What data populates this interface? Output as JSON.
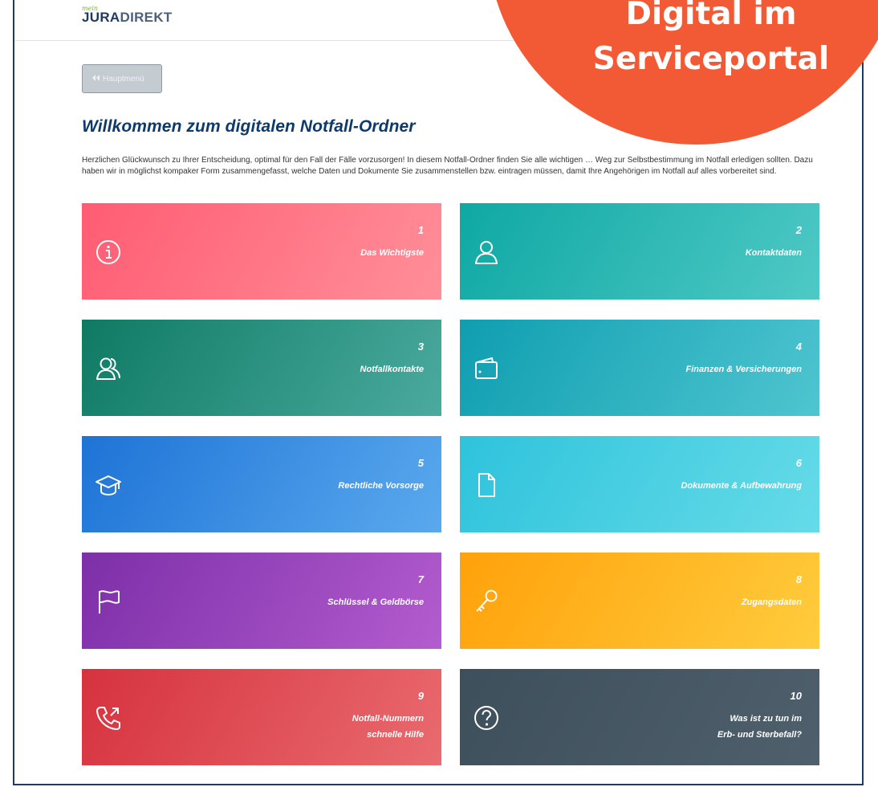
{
  "header": {
    "logo_small": "mein",
    "logo_primary": "JURA",
    "logo_secondary": "DIREKT"
  },
  "menu_button": {
    "icon": "double-chevron-left-icon",
    "label": "Hauptmenü"
  },
  "page": {
    "title": "Willkommen zum digitalen Notfall-Ordner",
    "intro": "Herzlichen Glückwunsch zu Ihrer Entscheidung, optimal für den Fall der Fälle vorzusorgen! In diesem Notfall-Ordner finden Sie alle wichtigen … Weg zur Selbstbestimmung im Notfall erledigen sollten. Dazu haben wir in möglichst kompaker Form zusammengefasst, welche Daten und Dokumente Sie zusammenstellen bzw. eintragen müssen, damit Ihre Angehörigen im Notfall auf alles vorbereitet sind."
  },
  "tiles": [
    {
      "number": "1",
      "label": "Das Wichtigste",
      "icon": "info-icon",
      "color_from": "#ff5c73",
      "color_to": "#ff8f99"
    },
    {
      "number": "2",
      "label": "Kontaktdaten",
      "icon": "person-icon",
      "color_from": "#0fa8a3",
      "color_to": "#4fc9c6"
    },
    {
      "number": "3",
      "label": "Notfallkontakte",
      "icon": "people-icon",
      "color_from": "#0f7a64",
      "color_to": "#4aaa9e"
    },
    {
      "number": "4",
      "label": "Finanzen & Versicherungen",
      "icon": "wallet-icon",
      "color_from": "#0f9eb0",
      "color_to": "#4fc5d0"
    },
    {
      "number": "5",
      "label": "Rechtliche Vorsorge",
      "icon": "graduation-cap-icon",
      "color_from": "#1e73d6",
      "color_to": "#5aa9ee"
    },
    {
      "number": "6",
      "label": "Dokumente & Aufbewahrung",
      "icon": "document-icon",
      "color_from": "#2ec3dc",
      "color_to": "#66dbe8"
    },
    {
      "number": "7",
      "label": "Schlüssel & Geldbörse",
      "icon": "flag-icon",
      "color_from": "#7d2fa8",
      "color_to": "#b35ccf"
    },
    {
      "number": "8",
      "label": "Zugangsdaten",
      "icon": "key-icon",
      "color_from": "#ffa10a",
      "color_to": "#ffcc3d"
    },
    {
      "number": "9",
      "label_lines": [
        "Notfall-Nummern",
        "schnelle Hilfe"
      ],
      "icon": "phone-call-icon",
      "color_from": "#d6323e",
      "color_to": "#e96b6f"
    },
    {
      "number": "10",
      "label_lines": [
        "Was ist zu tun im",
        "Erb- und Sterbefall?"
      ],
      "icon": "question-icon",
      "color_from": "#3e4f5c",
      "color_to": "#4f606c"
    }
  ],
  "callout": {
    "line1": "Digital im",
    "line2": "Serviceportal",
    "color": "#f15a35"
  }
}
